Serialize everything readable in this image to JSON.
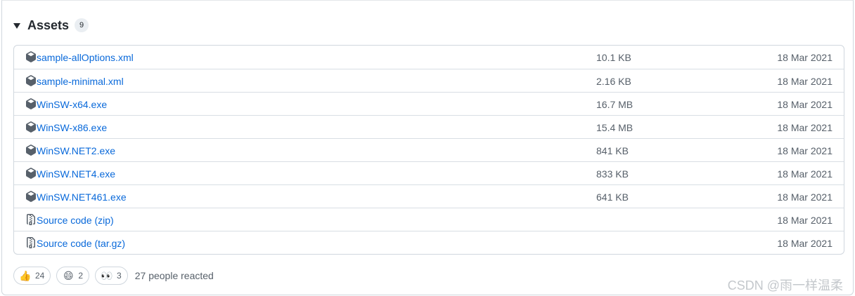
{
  "assets": {
    "title": "Assets",
    "count": "9",
    "rows": [
      {
        "icon": "package-icon",
        "name": "sample-allOptions.xml",
        "suffix": "",
        "size": "10.1 KB",
        "date": "18 Mar 2021"
      },
      {
        "icon": "package-icon",
        "name": "sample-minimal.xml",
        "suffix": "",
        "size": "2.16 KB",
        "date": "18 Mar 2021"
      },
      {
        "icon": "package-icon",
        "name": "WinSW-x64.exe",
        "suffix": "",
        "size": "16.7 MB",
        "date": "18 Mar 2021"
      },
      {
        "icon": "package-icon",
        "name": "WinSW-x86.exe",
        "suffix": "",
        "size": "15.4 MB",
        "date": "18 Mar 2021"
      },
      {
        "icon": "package-icon",
        "name": "WinSW.NET2.exe",
        "suffix": "",
        "size": "841 KB",
        "date": "18 Mar 2021"
      },
      {
        "icon": "package-icon",
        "name": "WinSW.NET4.exe",
        "suffix": "",
        "size": "833 KB",
        "date": "18 Mar 2021"
      },
      {
        "icon": "package-icon",
        "name": "WinSW.NET461.exe",
        "suffix": "",
        "size": "641 KB",
        "date": "18 Mar 2021"
      },
      {
        "icon": "file-zip-icon",
        "name": "Source code",
        "suffix": " (zip)",
        "size": "",
        "date": "18 Mar 2021"
      },
      {
        "icon": "file-zip-icon",
        "name": "Source code",
        "suffix": " (tar.gz)",
        "size": "",
        "date": "18 Mar 2021"
      }
    ]
  },
  "reactions": {
    "items": [
      {
        "emoji": "👍",
        "icon": "thumbs-up-icon",
        "count": "24"
      },
      {
        "emoji": "😄",
        "icon": "smile-icon",
        "count": "2"
      },
      {
        "emoji": "👀",
        "icon": "eyes-icon",
        "count": "3"
      }
    ],
    "summary": "27 people reacted"
  },
  "watermark": "CSDN @雨一样温柔",
  "colors": {
    "link": "#0969da",
    "muted": "#57606a",
    "border": "#d0d7de"
  }
}
